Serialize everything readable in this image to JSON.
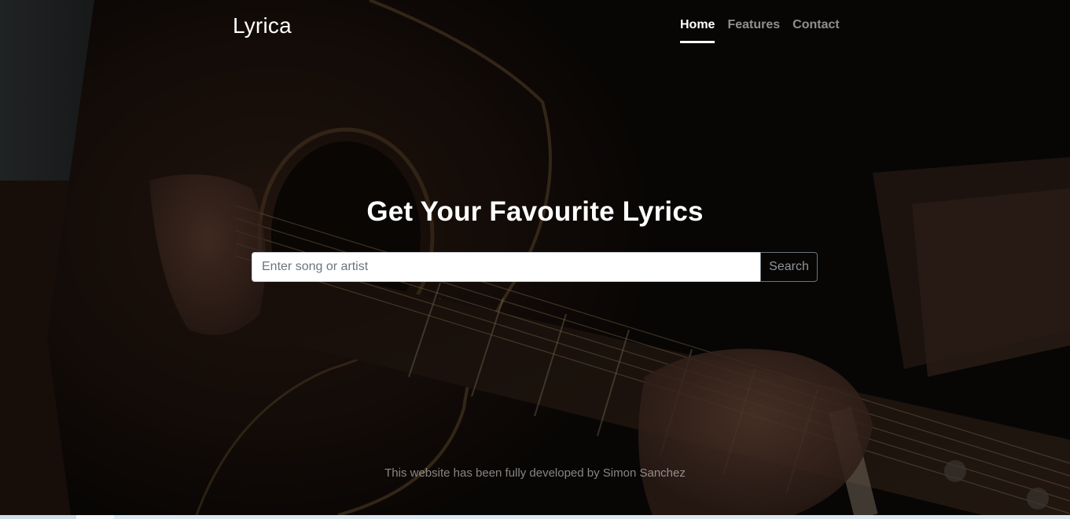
{
  "header": {
    "brand": "Lyrica",
    "nav": [
      {
        "label": "Home",
        "active": true
      },
      {
        "label": "Features",
        "active": false
      },
      {
        "label": "Contact",
        "active": false
      }
    ]
  },
  "hero": {
    "title": "Get Your Favourite Lyrics",
    "search": {
      "placeholder": "Enter song or artist",
      "value": "",
      "button_label": "Search"
    }
  },
  "footer": {
    "text": "This website has been fully developed by Simon Sanchez"
  },
  "background": {
    "image": "guitar-player-photo"
  },
  "colors": {
    "text_primary": "#ffffff",
    "text_muted": "rgba(255,255,255,0.5)",
    "button_border": "#6c757d"
  }
}
